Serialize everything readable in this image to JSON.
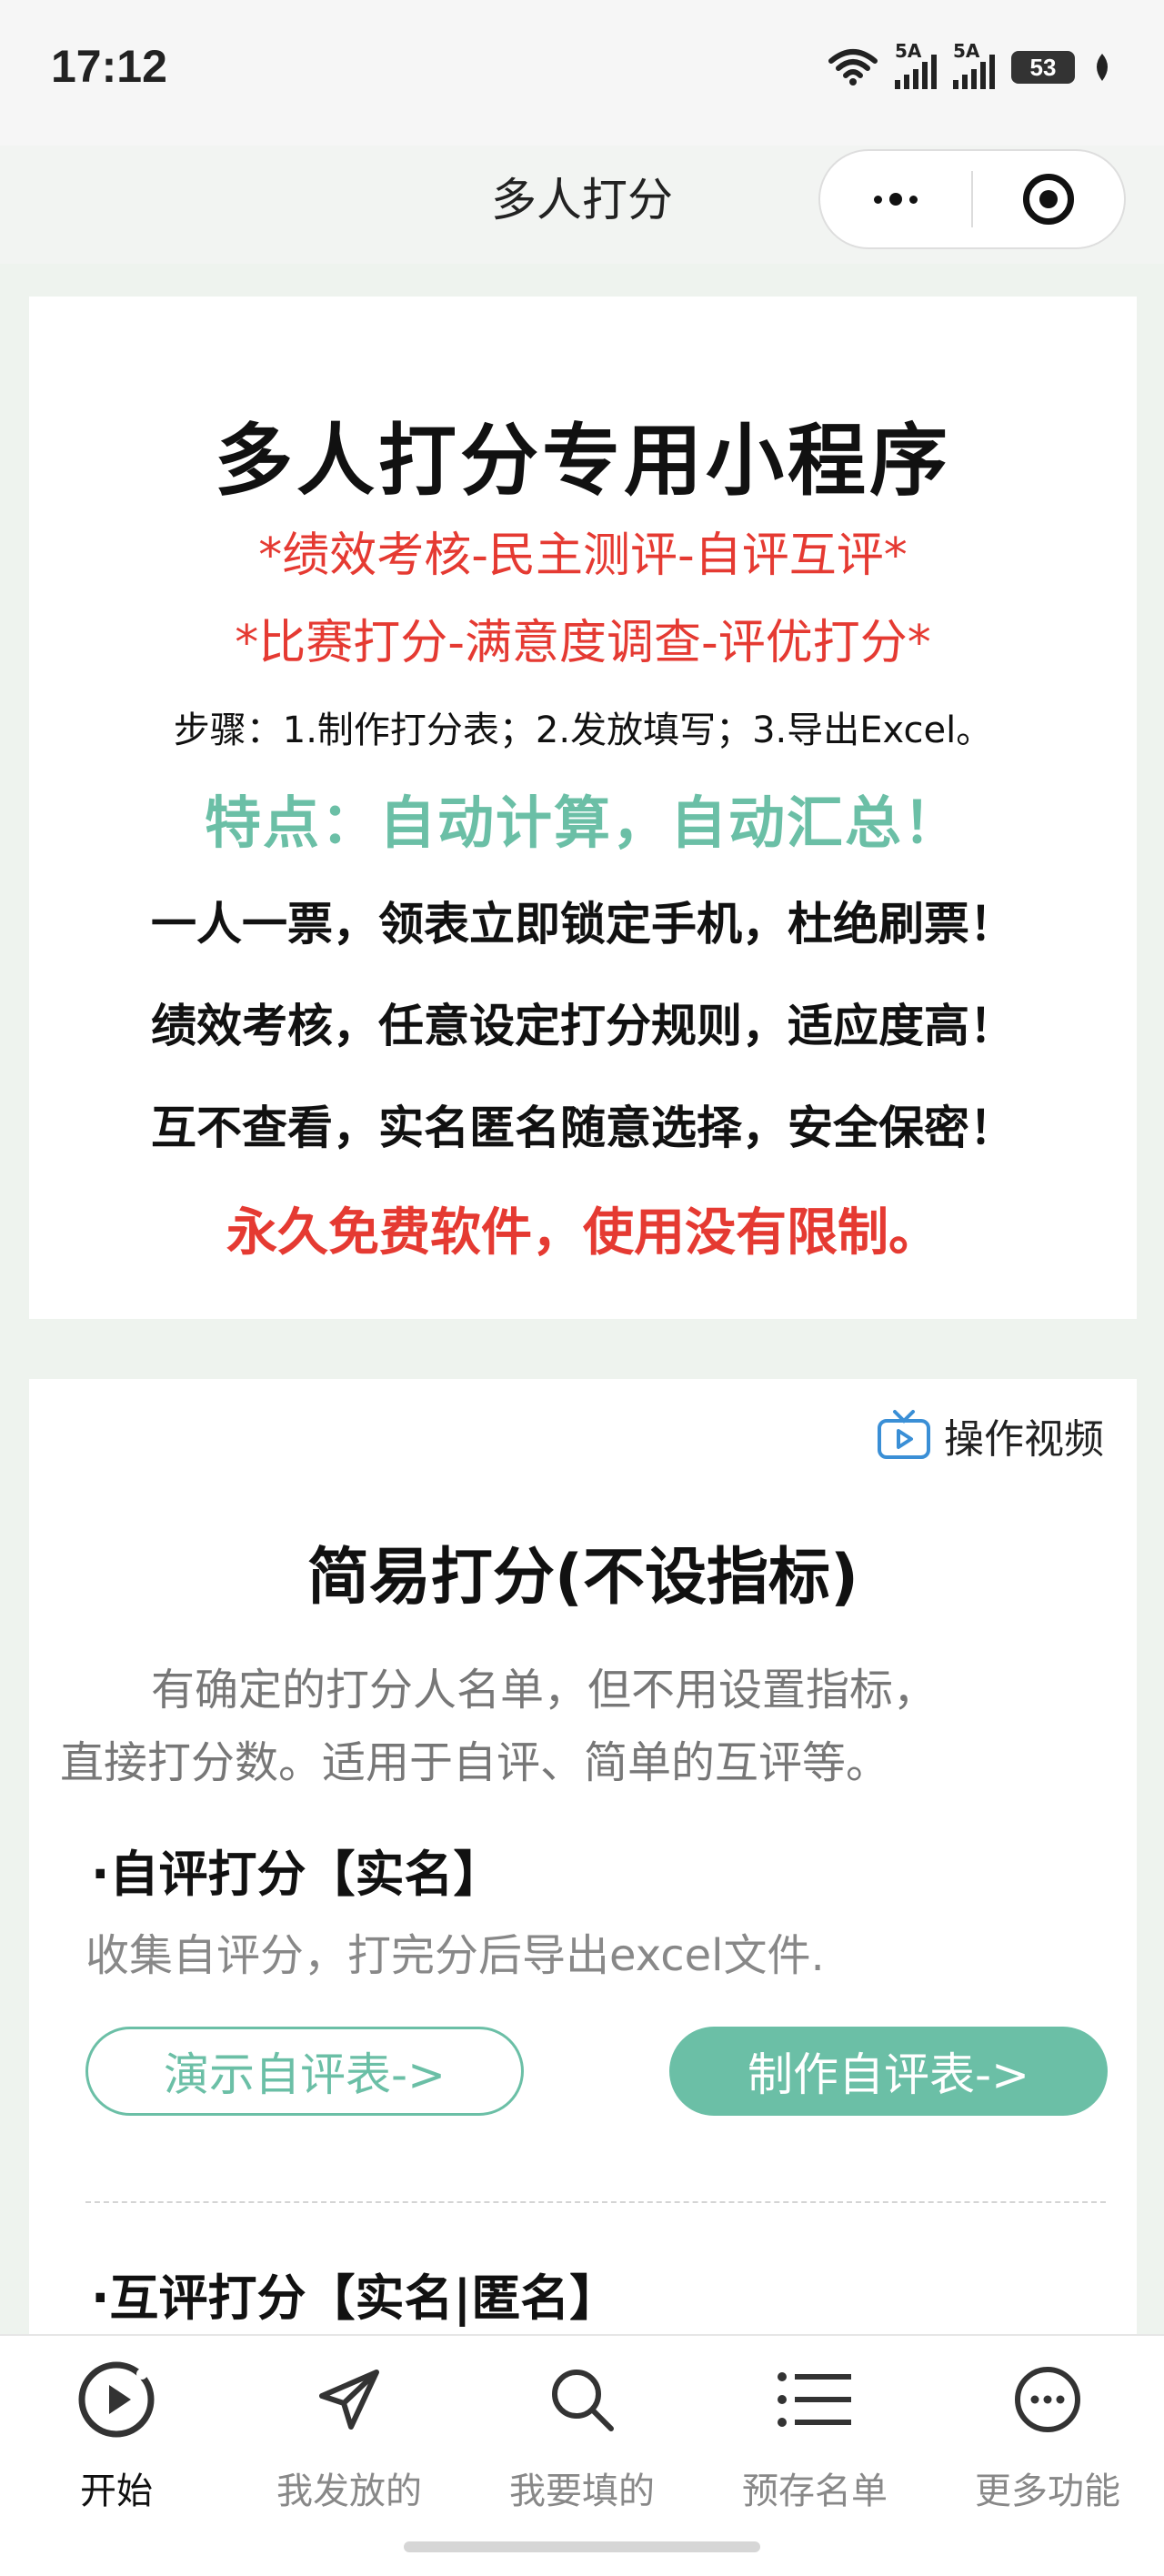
{
  "status_bar": {
    "time": "17:12",
    "signal1_label": "5A",
    "signal2_label": "5A",
    "battery": "53"
  },
  "nav": {
    "title": "多人打分"
  },
  "intro_card": {
    "title": "多人打分专用小程序",
    "tag_line_1": "*绩效考核-民主测评-自评互评*",
    "tag_line_2": "*比赛打分-满意度调查-评优打分*",
    "steps": "步骤：1.制作打分表；2.发放填写；3.导出Excel。",
    "feature": "特点：自动计算，自动汇总！",
    "bullet_1": "一人一票，领表立即锁定手机，杜绝刷票！",
    "bullet_2": "绩效考核，任意设定打分规则，适应度高！",
    "bullet_3": "互不查看，实名匿名随意选择，安全保密！",
    "free_note": "永久免费软件，使用没有限制。"
  },
  "simple_card": {
    "video_link": "操作视频",
    "title": "简易打分(不设指标)",
    "desc_line_1": "有确定的打分人名单，但不用设置指标，",
    "desc_line_2": "直接打分数。适用于自评、简单的互评等。",
    "section_1_title": "·自评打分【实名】",
    "section_1_desc": "收集自评分，打完分后导出excel文件.",
    "demo_button": "演示自评表->",
    "make_button": "制作自评表->",
    "section_2_title": "·互评打分【实名|匿名】"
  },
  "tabbar": {
    "items": [
      {
        "label": "开始",
        "icon": "play-circle-icon"
      },
      {
        "label": "我发放的",
        "icon": "send-icon"
      },
      {
        "label": "我要填的",
        "icon": "search-icon"
      },
      {
        "label": "预存名单",
        "icon": "list-icon"
      },
      {
        "label": "更多功能",
        "icon": "more-circle-icon"
      }
    ]
  },
  "colors": {
    "accent_green": "#6bbfa6",
    "accent_red": "#e53a32"
  }
}
